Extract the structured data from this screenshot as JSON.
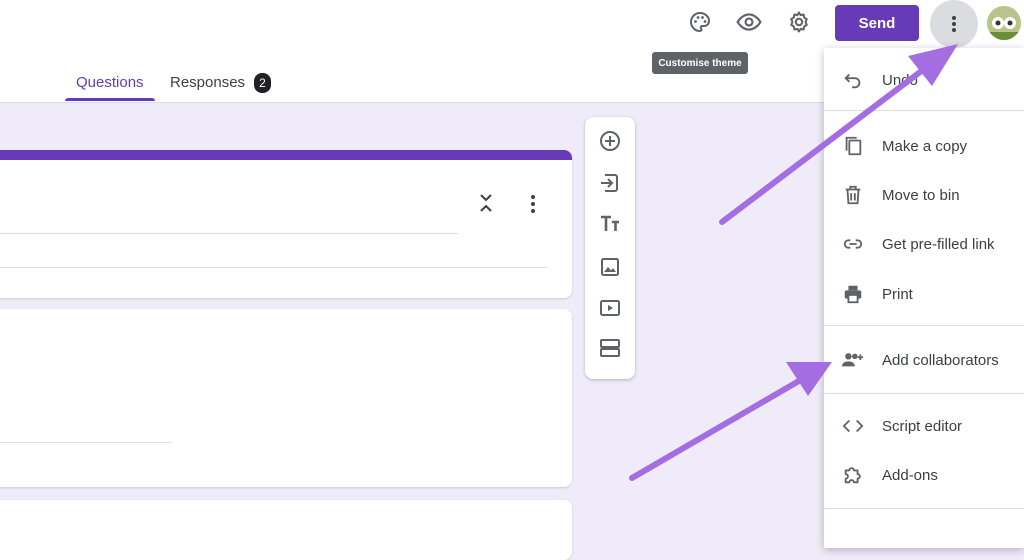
{
  "header": {
    "send_label": "Send",
    "tooltip": "Customise theme",
    "icons": [
      "palette-icon",
      "eye-icon",
      "gear-icon",
      "more-vert-icon"
    ]
  },
  "tabs": [
    {
      "label": "Questions",
      "active": true
    },
    {
      "label": "Responses",
      "badge": "2"
    }
  ],
  "side_toolbar": {
    "icons": [
      "add-question-icon",
      "import-questions-icon",
      "add-title-icon",
      "add-image-icon",
      "add-video-icon",
      "add-section-icon"
    ]
  },
  "menu": {
    "items": [
      {
        "label": "Undo",
        "icon": "undo-icon"
      },
      {
        "label": "Make a copy",
        "icon": "copy-icon"
      },
      {
        "label": "Move to bin",
        "icon": "trash-icon"
      },
      {
        "label": "Get pre-filled link",
        "icon": "link-icon"
      },
      {
        "label": "Print",
        "icon": "print-icon"
      },
      {
        "label": "Add collaborators",
        "icon": "add-people-icon"
      },
      {
        "label": "Script editor",
        "icon": "code-icon"
      },
      {
        "label": "Add-ons",
        "icon": "puzzle-icon"
      }
    ]
  },
  "colors": {
    "accent": "#673ab7",
    "background": "#f0ebf8",
    "annotation_arrow": "#a56de2"
  }
}
